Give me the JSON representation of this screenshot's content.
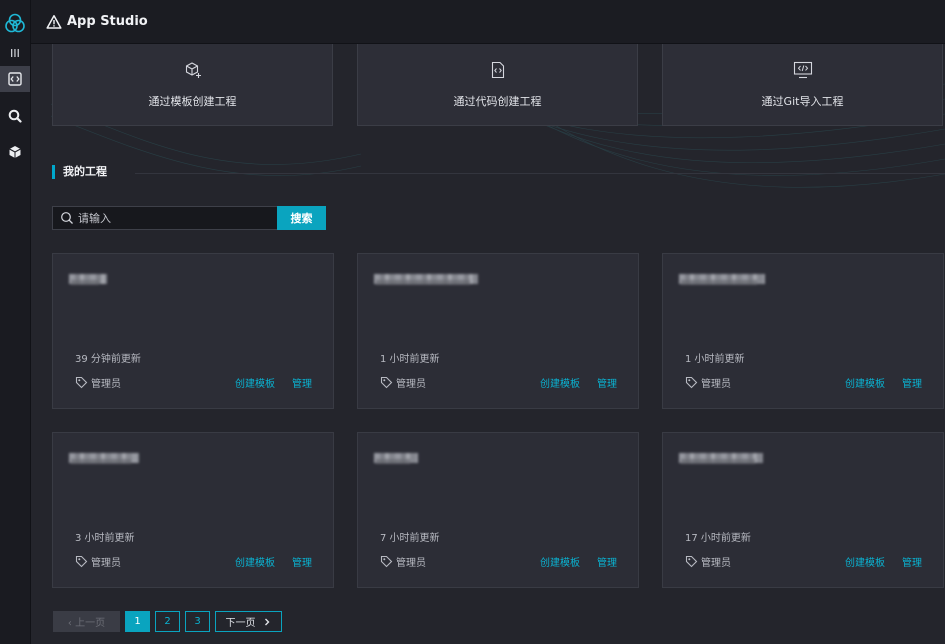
{
  "app": {
    "title": "App Studio"
  },
  "actions": [
    {
      "label": "通过模板创建工程",
      "icon": "cube-plus-icon"
    },
    {
      "label": "通过代码创建工程",
      "icon": "code-file-icon"
    },
    {
      "label": "通过Git导入工程",
      "icon": "code-monitor-icon"
    }
  ],
  "section": {
    "title": "我的工程"
  },
  "search": {
    "placeholder": "请输入",
    "button": "搜索"
  },
  "projects": [
    {
      "updated": "39 分钟前更新",
      "role": "管理员",
      "create_template": "创建模板",
      "manage": "管理"
    },
    {
      "updated": "1 小时前更新",
      "role": "管理员",
      "create_template": "创建模板",
      "manage": "管理"
    },
    {
      "updated": "1 小时前更新",
      "role": "管理员",
      "create_template": "创建模板",
      "manage": "管理"
    },
    {
      "updated": "3 小时前更新",
      "role": "管理员",
      "create_template": "创建模板",
      "manage": "管理"
    },
    {
      "updated": "7 小时前更新",
      "role": "管理员",
      "create_template": "创建模板",
      "manage": "管理"
    },
    {
      "updated": "17 小时前更新",
      "role": "管理员",
      "create_template": "创建模板",
      "manage": "管理"
    }
  ],
  "pagination": {
    "prev": "上一页",
    "pages": [
      "1",
      "2",
      "3"
    ],
    "current": "1",
    "next": "下一页"
  },
  "colors": {
    "accent": "#0aa4bf",
    "background": "#24252c",
    "card": "#2c2d36"
  }
}
